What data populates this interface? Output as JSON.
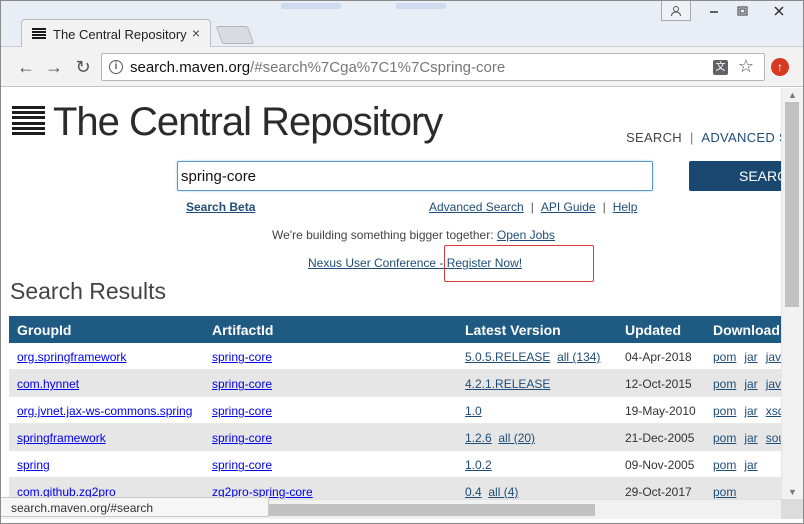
{
  "browser": {
    "tab_title": "The Central Repository",
    "tab_close": "×",
    "url_host": "search.maven.org",
    "url_path": "/#search%7Cga%7C1%7Cspring-core",
    "status_url": "search.maven.org/#search"
  },
  "site": {
    "logo_text": "The Central Repository",
    "nav": {
      "search": "SEARCH",
      "sep": "|",
      "advanced": "ADVANCED S"
    },
    "search_value": "spring-core",
    "search_button": "SEARCH",
    "search_beta": "Search Beta",
    "advanced_search": "Advanced Search",
    "api_guide": "API Guide",
    "help": "Help",
    "bigger_text": "We're building something bigger together:",
    "open_jobs": "Open Jobs",
    "conference": "Nexus User Conference - Register Now!"
  },
  "results": {
    "title": "Search Results",
    "columns": {
      "group": "GroupId",
      "artifact": "ArtifactId",
      "version": "Latest Version",
      "updated": "Updated",
      "download": "Download"
    },
    "rows": [
      {
        "group": "org.springframework",
        "artifact": "spring-core",
        "version": "5.0.5.RELEASE",
        "all": "all (134)",
        "updated": "04-Apr-2018",
        "downloads": [
          "pom",
          "jar",
          "jav"
        ]
      },
      {
        "group": "com.hynnet",
        "artifact": "spring-core",
        "version": "4.2.1.RELEASE",
        "all": "",
        "updated": "12-Oct-2015",
        "downloads": [
          "pom",
          "jar",
          "jav"
        ]
      },
      {
        "group": "org.jvnet.jax-ws-commons.spring",
        "artifact": "spring-core",
        "version": "1.0",
        "all": "",
        "updated": "19-May-2010",
        "downloads": [
          "pom",
          "jar",
          "xsd"
        ]
      },
      {
        "group": "springframework",
        "artifact": "spring-core",
        "version": "1.2.6",
        "all": "all (20)",
        "updated": "21-Dec-2005",
        "downloads": [
          "pom",
          "jar",
          "sou"
        ]
      },
      {
        "group": "spring",
        "artifact": "spring-core",
        "version": "1.0.2",
        "all": "",
        "updated": "09-Nov-2005",
        "downloads": [
          "pom",
          "jar"
        ]
      },
      {
        "group": "com.github.zg2pro",
        "artifact": "zg2pro-spring-core",
        "version": "0.4",
        "all": "all (4)",
        "updated": "29-Oct-2017",
        "downloads": [
          "pom"
        ]
      }
    ]
  },
  "colors": {
    "header_bg": "#1e5a82",
    "link": "#1f4d78",
    "highlight": "#d93a3a"
  }
}
